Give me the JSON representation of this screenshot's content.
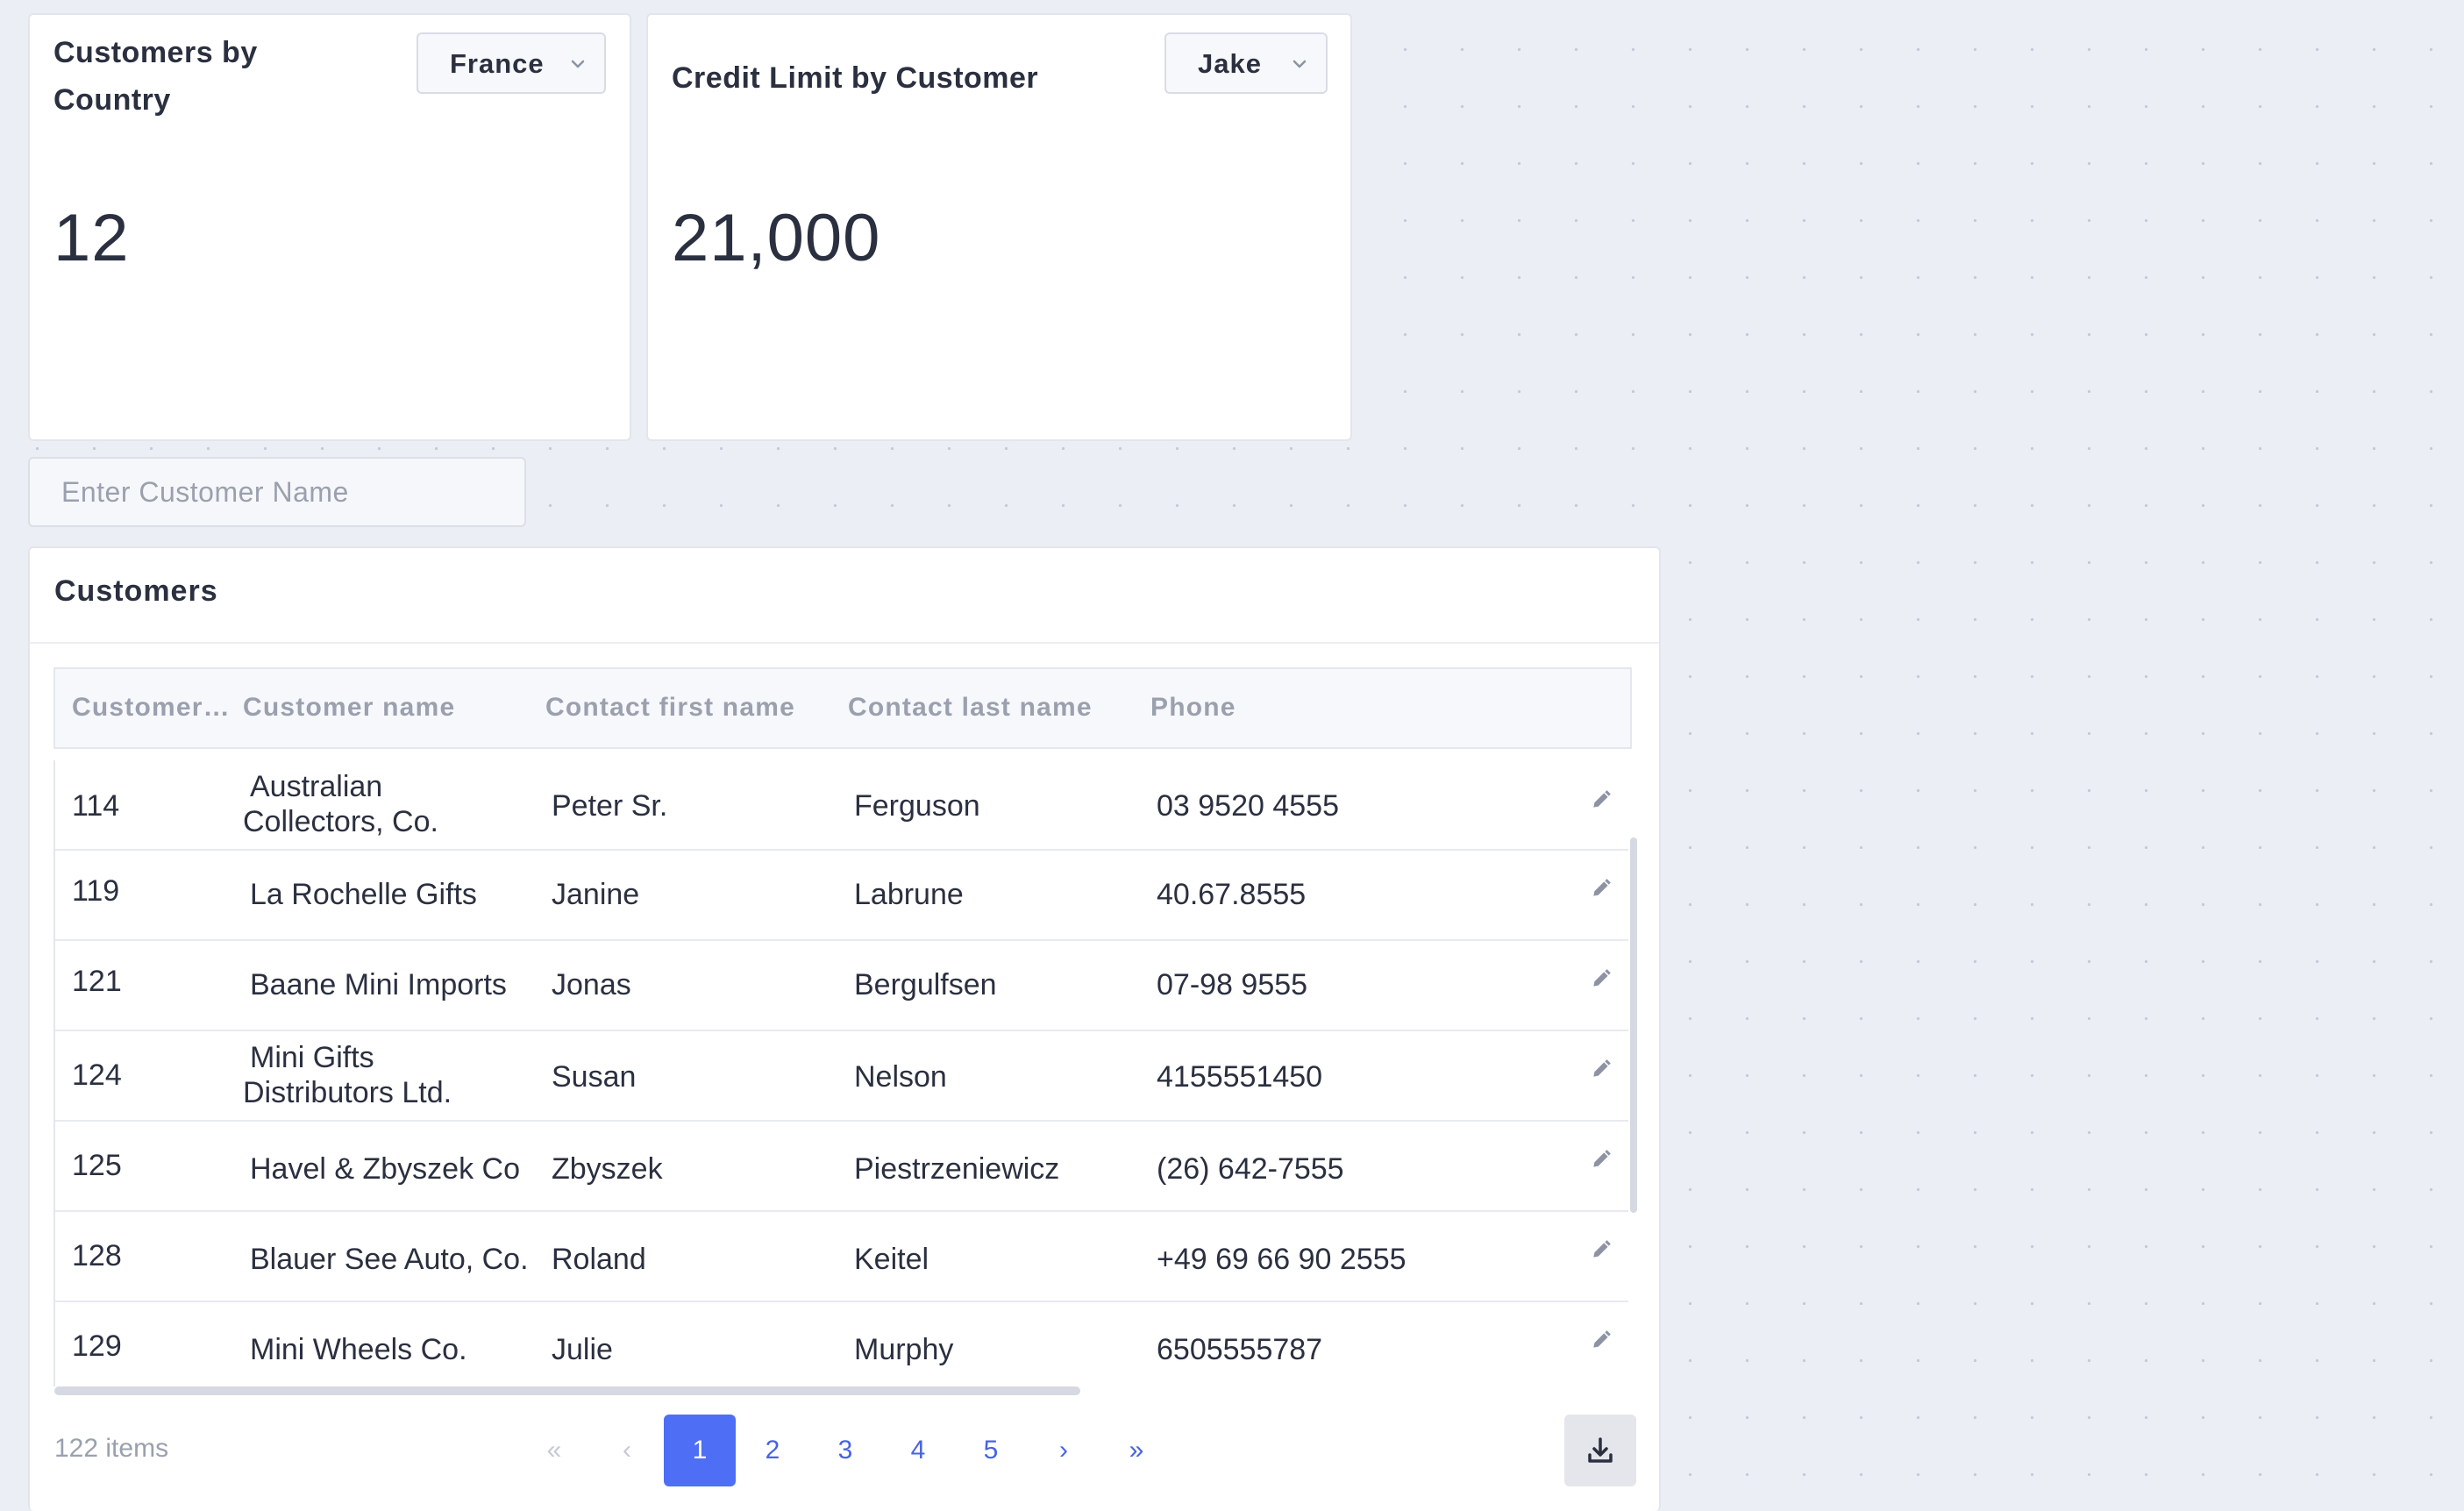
{
  "country_card": {
    "title_line1": "Customers by",
    "title_line2": "Country",
    "selected_country": "France",
    "value": "12"
  },
  "credit_card": {
    "title": "Credit Limit by Customer",
    "selected_customer": "Jake",
    "value": "21,000"
  },
  "search": {
    "placeholder": "Enter Customer Name"
  },
  "customers_table": {
    "title": "Customers",
    "columns": [
      "Customer…",
      "Customer name",
      "Contact first name",
      "Contact last name",
      "Phone"
    ],
    "rows": [
      {
        "id": "114",
        "name_line1": "Australian",
        "name_line2": "Collectors, Co.",
        "first": "Peter Sr.",
        "last": "Ferguson",
        "phone": "03 9520 4555"
      },
      {
        "id": "119",
        "name_line1": "La Rochelle Gifts",
        "name_line2": "",
        "first": "Janine",
        "last": "Labrune",
        "phone": "40.67.8555"
      },
      {
        "id": "121",
        "name_line1": "Baane Mini Imports",
        "name_line2": "",
        "first": "Jonas",
        "last": "Bergulfsen",
        "phone": "07-98 9555"
      },
      {
        "id": "124",
        "name_line1": "Mini Gifts",
        "name_line2": "Distributors Ltd.",
        "first": "Susan",
        "last": "Nelson",
        "phone": "4155551450"
      },
      {
        "id": "125",
        "name_line1": "Havel & Zbyszek Co",
        "name_line2": "",
        "first": "Zbyszek",
        "last": "Piestrzeniewicz",
        "phone": "(26) 642-7555"
      },
      {
        "id": "128",
        "name_line1": "Blauer See Auto, Co.",
        "name_line2": "",
        "first": "Roland",
        "last": "Keitel",
        "phone": "+49 69 66 90 2555"
      },
      {
        "id": "129",
        "name_line1": "Mini Wheels Co.",
        "name_line2": "",
        "first": "Julie",
        "last": "Murphy",
        "phone": "6505555787"
      }
    ],
    "items_count": "122 items",
    "pagination": {
      "first": "«",
      "prev": "‹",
      "pages": [
        "1",
        "2",
        "3",
        "4",
        "5"
      ],
      "current": "1",
      "next": "›",
      "last": "»"
    }
  },
  "icons": {
    "dropdown": "chevron-down-icon",
    "edit": "pencil-icon",
    "download": "download-icon"
  },
  "colors": {
    "accent": "#4d6ef5",
    "link": "#4763e4",
    "muted_text": "#9aa0ae",
    "text": "#2b3040"
  }
}
